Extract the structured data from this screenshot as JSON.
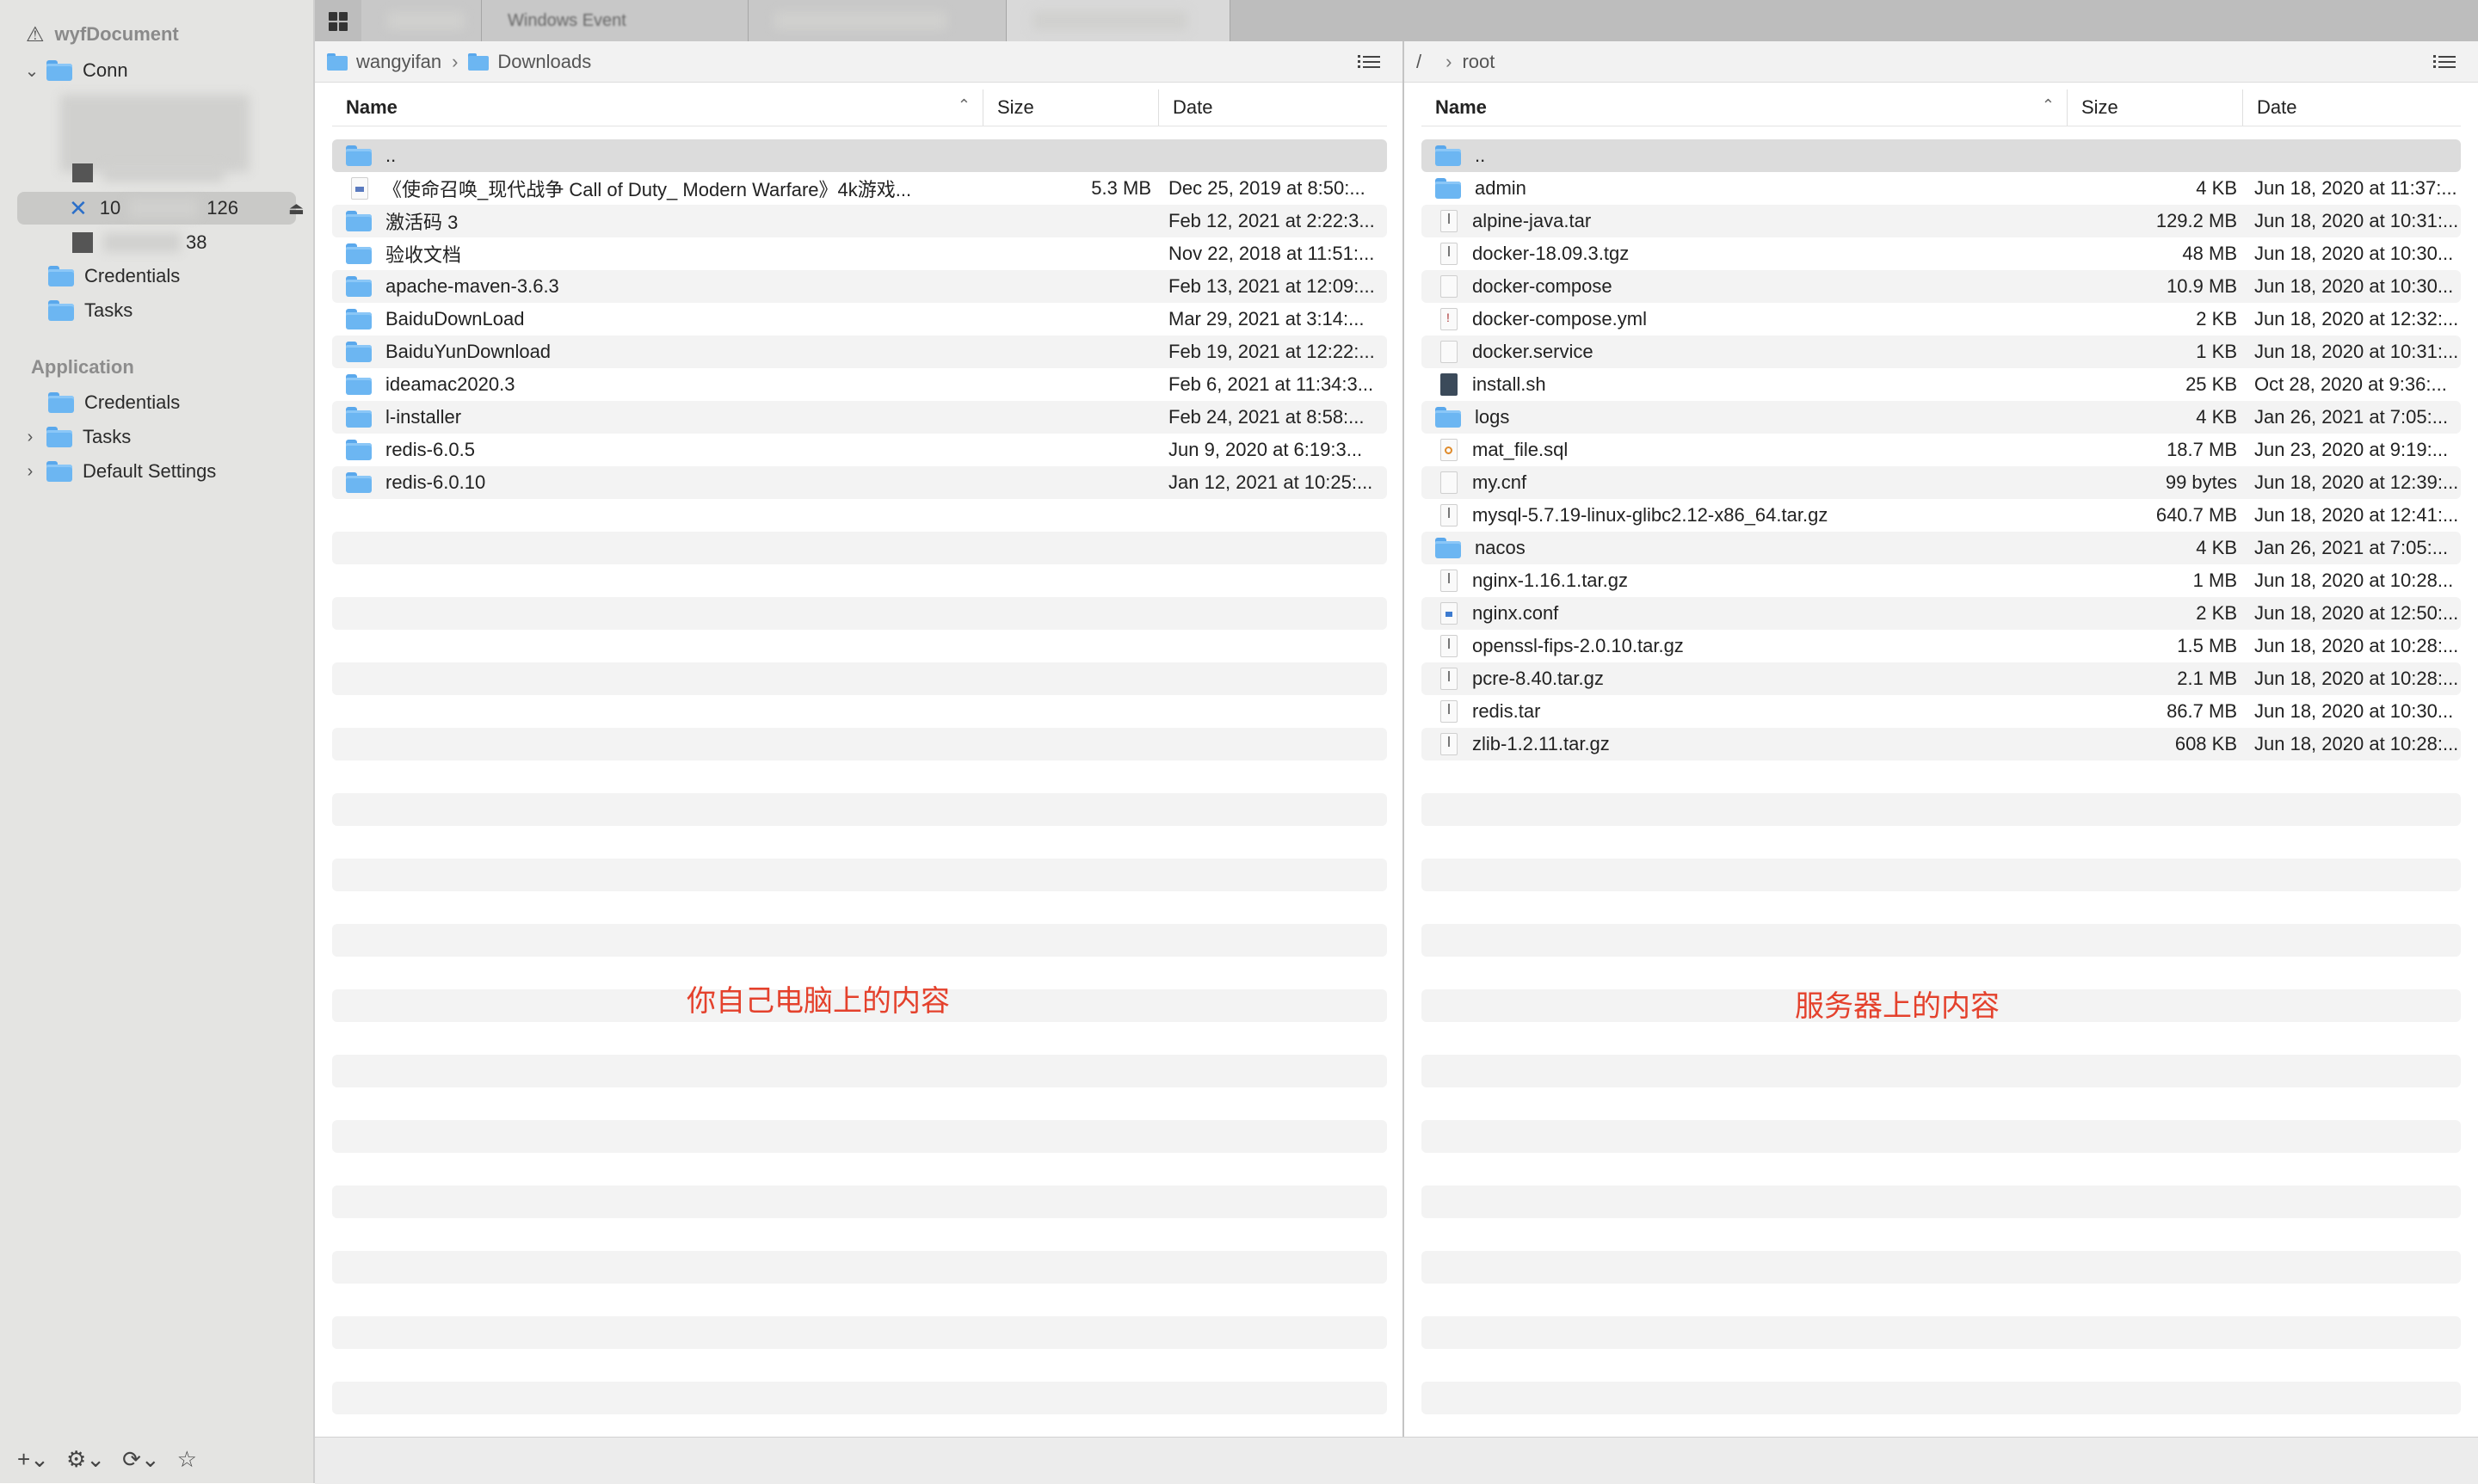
{
  "sidebar": {
    "title": "wyfDocument",
    "connections_label": "Conn",
    "connection_name": "10",
    "connection_suffix": "126",
    "other_suffix": "38",
    "credentials_label": "Credentials",
    "tasks_label": "Tasks",
    "section_application": "Application",
    "app_items": [
      "Credentials",
      "Tasks",
      "Default Settings"
    ]
  },
  "tabs": [
    {
      "label": "wyf"
    },
    {
      "label": "Windows Event"
    },
    {
      "label": "redis"
    },
    {
      "label": "10.10.100.126"
    }
  ],
  "left_pane": {
    "path": [
      "wangyifan",
      "Downloads"
    ],
    "columns": {
      "name": "Name",
      "size": "Size",
      "date": "Date"
    },
    "rows": [
      {
        "type": "folder",
        "name": "..",
        "size": "",
        "date": ""
      },
      {
        "type": "doc",
        "name": "《使命召唤_现代战争 Call of Duty_ Modern Warfare》4k游戏...",
        "size": "5.3 MB",
        "date": "Dec 25, 2019 at 8:50:..."
      },
      {
        "type": "folder",
        "name": "激活码 3",
        "size": "",
        "date": "Feb 12, 2021 at 2:22:3..."
      },
      {
        "type": "folder",
        "name": "验收文档",
        "size": "",
        "date": "Nov 22, 2018 at 11:51:..."
      },
      {
        "type": "folder",
        "name": "apache-maven-3.6.3",
        "size": "",
        "date": "Feb 13, 2021 at 12:09:..."
      },
      {
        "type": "folder",
        "name": "BaiduDownLoad",
        "size": "",
        "date": "Mar 29, 2021 at 3:14:..."
      },
      {
        "type": "folder",
        "name": "BaiduYunDownload",
        "size": "",
        "date": "Feb 19, 2021 at 12:22:..."
      },
      {
        "type": "folder",
        "name": "ideamac2020.3",
        "size": "",
        "date": "Feb 6, 2021 at 11:34:3..."
      },
      {
        "type": "folder",
        "name": "l-installer",
        "size": "",
        "date": "Feb 24, 2021 at 8:58:..."
      },
      {
        "type": "folder",
        "name": "redis-6.0.5",
        "size": "",
        "date": "Jun 9, 2020 at 6:19:3..."
      },
      {
        "type": "folder",
        "name": "redis-6.0.10",
        "size": "",
        "date": "Jan 12, 2021 at 10:25:..."
      }
    ],
    "annotation": "你自己电脑上的内容"
  },
  "right_pane": {
    "path_root": "/",
    "path": [
      "root"
    ],
    "columns": {
      "name": "Name",
      "size": "Size",
      "date": "Date"
    },
    "rows": [
      {
        "type": "folder",
        "name": "..",
        "size": "",
        "date": ""
      },
      {
        "type": "folder",
        "name": "admin",
        "size": "4 KB",
        "date": "Jun 18, 2020 at 11:37:..."
      },
      {
        "type": "archive",
        "name": "alpine-java.tar",
        "size": "129.2 MB",
        "date": "Jun 18, 2020 at 10:31:..."
      },
      {
        "type": "archive",
        "name": "docker-18.09.3.tgz",
        "size": "48 MB",
        "date": "Jun 18, 2020 at 10:30..."
      },
      {
        "type": "file",
        "name": "docker-compose",
        "size": "10.9 MB",
        "date": "Jun 18, 2020 at 10:30..."
      },
      {
        "type": "yml",
        "name": "docker-compose.yml",
        "size": "2 KB",
        "date": "Jun 18, 2020 at 12:32:..."
      },
      {
        "type": "file",
        "name": "docker.service",
        "size": "1 KB",
        "date": "Jun 18, 2020 at 10:31:..."
      },
      {
        "type": "script",
        "name": "install.sh",
        "size": "25 KB",
        "date": "Oct 28, 2020 at 9:36:..."
      },
      {
        "type": "folder",
        "name": "logs",
        "size": "4 KB",
        "date": "Jan 26, 2021 at 7:05:..."
      },
      {
        "type": "sql",
        "name": "mat_file.sql",
        "size": "18.7 MB",
        "date": "Jun 23, 2020 at 9:19:..."
      },
      {
        "type": "file",
        "name": "my.cnf",
        "size": "99 bytes",
        "date": "Jun 18, 2020 at 12:39:..."
      },
      {
        "type": "archive",
        "name": "mysql-5.7.19-linux-glibc2.12-x86_64.tar.gz",
        "size": "640.7 MB",
        "date": "Jun 18, 2020 at 12:41:..."
      },
      {
        "type": "folder",
        "name": "nacos",
        "size": "4 KB",
        "date": "Jan 26, 2021 at 7:05:..."
      },
      {
        "type": "archive",
        "name": "nginx-1.16.1.tar.gz",
        "size": "1 MB",
        "date": "Jun 18, 2020 at 10:28..."
      },
      {
        "type": "conf",
        "name": "nginx.conf",
        "size": "2 KB",
        "date": "Jun 18, 2020 at 12:50:..."
      },
      {
        "type": "archive",
        "name": "openssl-fips-2.0.10.tar.gz",
        "size": "1.5 MB",
        "date": "Jun 18, 2020 at 10:28:..."
      },
      {
        "type": "archive",
        "name": "pcre-8.40.tar.gz",
        "size": "2.1 MB",
        "date": "Jun 18, 2020 at 10:28:..."
      },
      {
        "type": "archive",
        "name": "redis.tar",
        "size": "86.7 MB",
        "date": "Jun 18, 2020 at 10:30..."
      },
      {
        "type": "archive",
        "name": "zlib-1.2.11.tar.gz",
        "size": "608 KB",
        "date": "Jun 18, 2020 at 10:28:..."
      }
    ],
    "annotation": "服务器上的内容"
  },
  "toolbar_icons": [
    "plus-icon",
    "gear-icon",
    "sync-icon",
    "star-icon"
  ]
}
